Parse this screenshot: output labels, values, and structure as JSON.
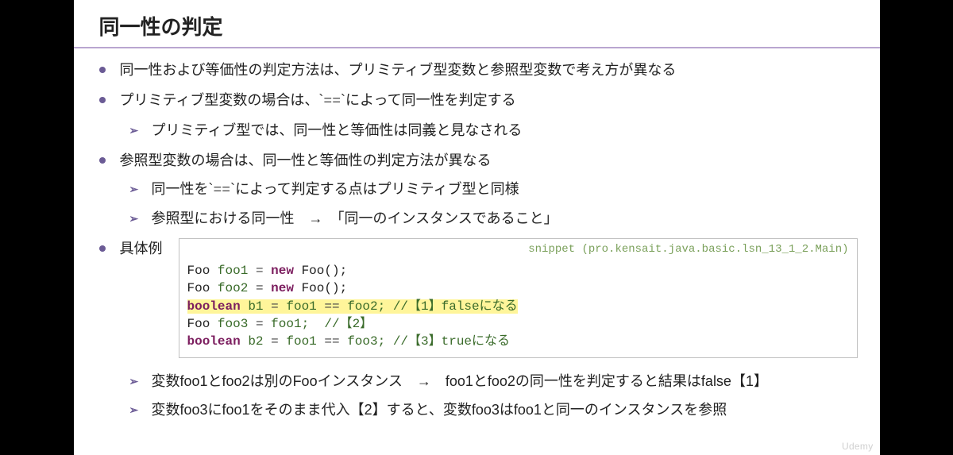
{
  "title": "同一性の判定",
  "bullets": {
    "b1": "同一性および等価性の判定方法は、プリミティブ型変数と参照型変数で考え方が異なる",
    "b2_pre": "プリミティブ型変数の場合は、`",
    "b2_op": "==",
    "b2_post": "`によって同一性を判定する",
    "b2_s1": "プリミティブ型では、同一性と等価性は同義と見なされる",
    "b3": "参照型変数の場合は、同一性と等価性の判定方法が異なる",
    "b3_s1_pre": "同一性を`",
    "b3_s1_op": "==",
    "b3_s1_post": "`によって判定する点はプリミティブ型と同様",
    "b3_s2": "参照型における同一性　→　「同一のインスタンスであること」",
    "b4": "具体例"
  },
  "code": {
    "snippet_path": "snippet (pro.kensait.java.basic.lsn_13_1_2.Main)",
    "l1": {
      "type": "Foo",
      "var": "foo1",
      "eq": "=",
      "kw": "new",
      "ctor": "Foo();"
    },
    "l2": {
      "type": "Foo",
      "var": "foo2",
      "eq": "=",
      "kw": "new",
      "ctor": "Foo();"
    },
    "l3": {
      "type": "boolean",
      "var": "b1",
      "eq": "=",
      "lhs": "foo1",
      "op": "==",
      "rhs": "foo2;",
      "cm": "//【1】falseになる"
    },
    "l4": {
      "type": "Foo",
      "var": "foo3",
      "eq": "=",
      "rhs": "foo1;",
      "cm": "//【2】"
    },
    "l5": {
      "type": "boolean",
      "var": "b2",
      "eq": "=",
      "lhs": "foo1",
      "op": "==",
      "rhs": "foo3;",
      "cm": "//【3】trueになる"
    }
  },
  "after": {
    "a1": "変数foo1とfoo2は別のFooインスタンス　→　foo1とfoo2の同一性を判定すると結果はfalse【1】",
    "a2": "変数foo3にfoo1をそのまま代入【2】すると、変数foo3はfoo1と同一のインスタンスを参照"
  },
  "watermark": "Udemy"
}
